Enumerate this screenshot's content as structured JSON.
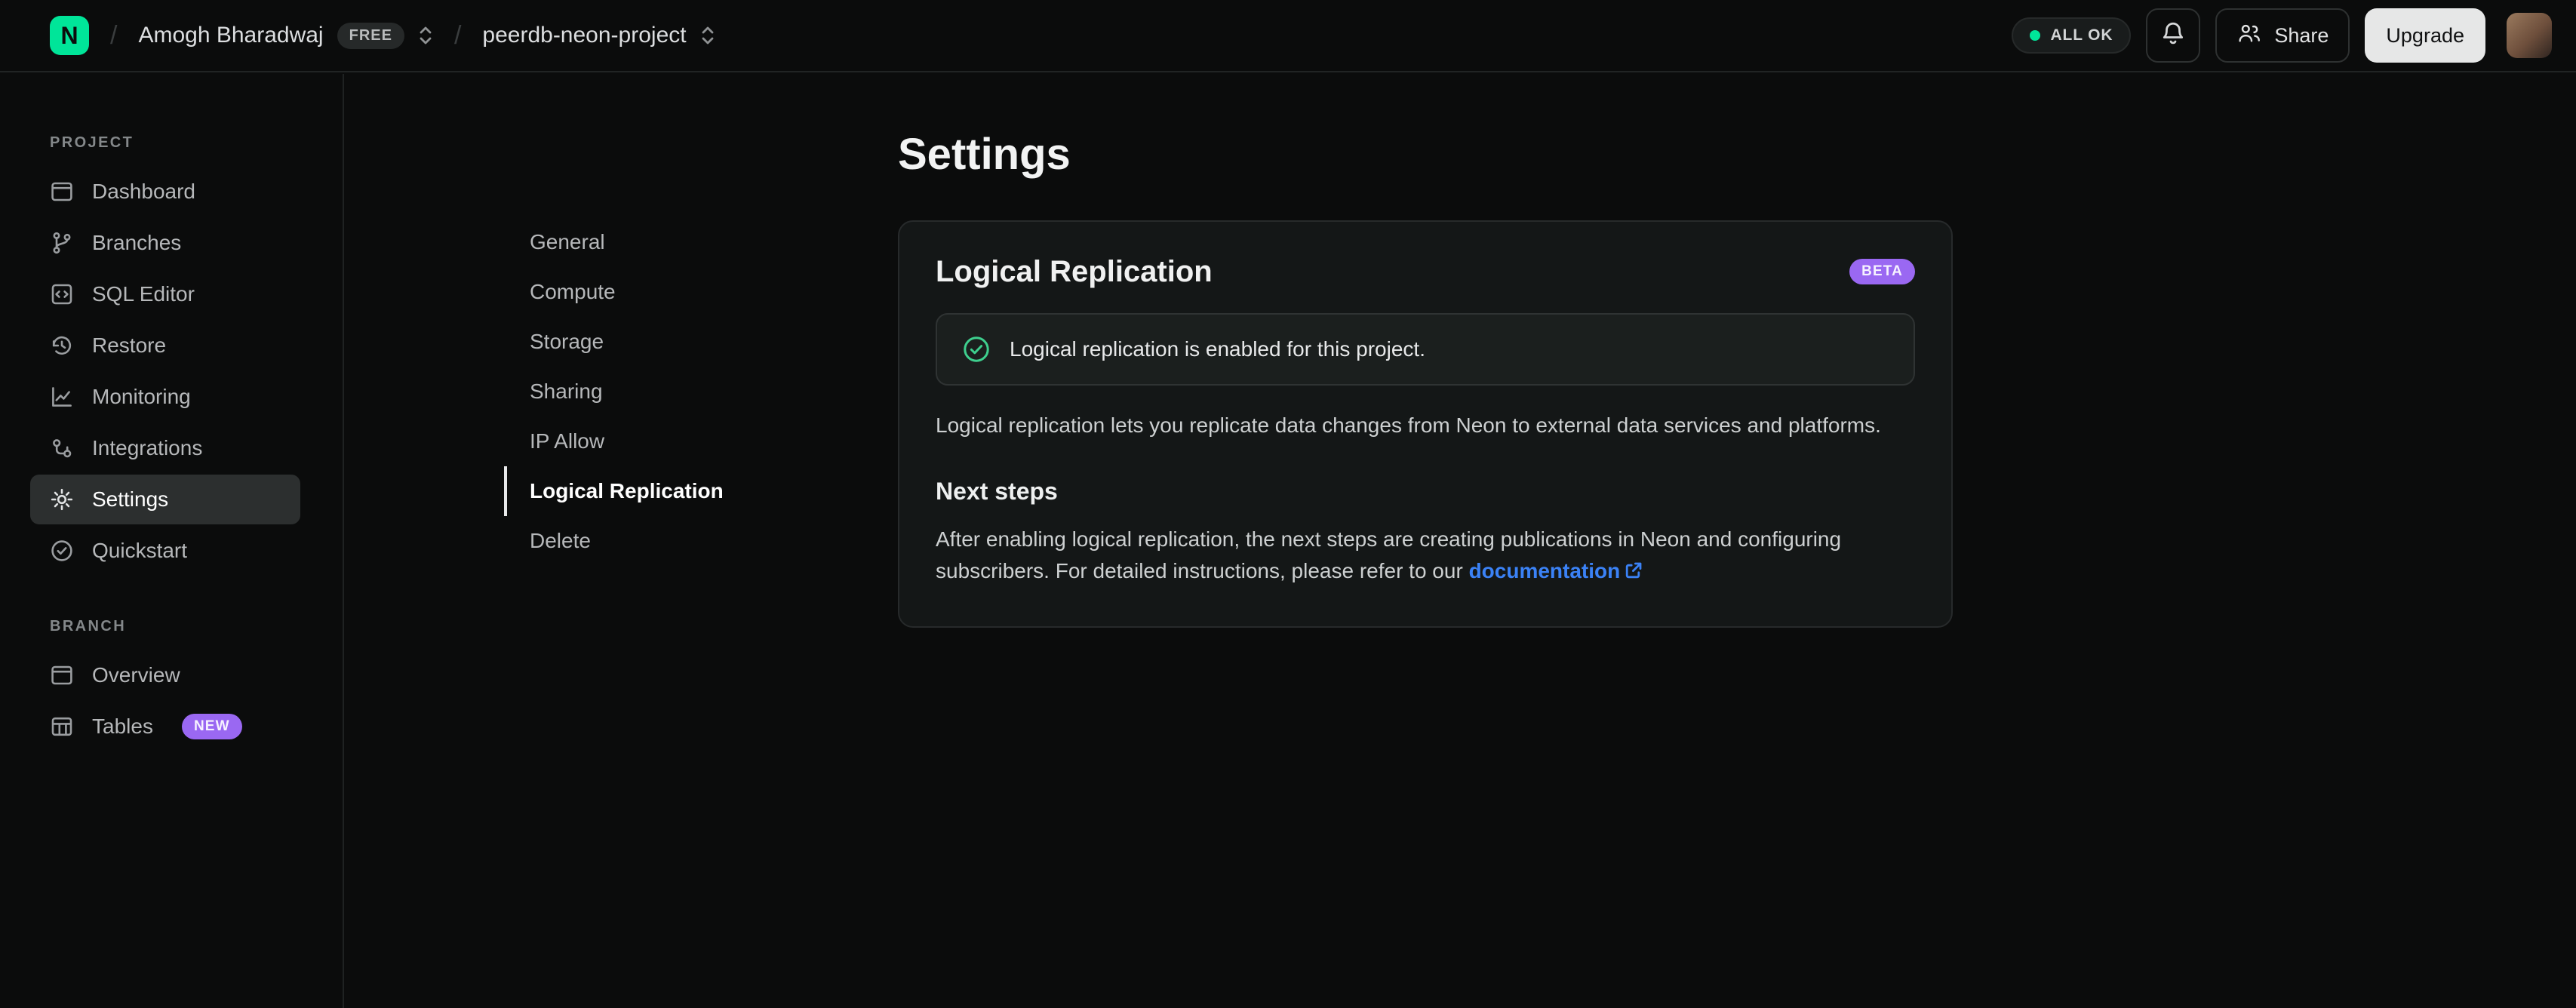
{
  "topbar": {
    "logo_letter": "N",
    "breadcrumb": {
      "org_name": "Amogh Bharadwaj",
      "org_badge": "FREE",
      "project_name": "peerdb-neon-project"
    },
    "status_label": "ALL OK",
    "share_label": "Share",
    "upgrade_label": "Upgrade"
  },
  "sidebar": {
    "sections": [
      {
        "label": "PROJECT",
        "items": [
          {
            "label": "Dashboard",
            "icon": "dashboard-icon"
          },
          {
            "label": "Branches",
            "icon": "branches-icon"
          },
          {
            "label": "SQL Editor",
            "icon": "sql-editor-icon"
          },
          {
            "label": "Restore",
            "icon": "restore-icon"
          },
          {
            "label": "Monitoring",
            "icon": "monitoring-icon"
          },
          {
            "label": "Integrations",
            "icon": "integrations-icon"
          },
          {
            "label": "Settings",
            "icon": "settings-icon"
          },
          {
            "label": "Quickstart",
            "icon": "quickstart-icon"
          }
        ]
      },
      {
        "label": "BRANCH",
        "items": [
          {
            "label": "Overview",
            "icon": "overview-icon"
          },
          {
            "label": "Tables",
            "icon": "tables-icon",
            "badge": "NEW"
          }
        ]
      }
    ]
  },
  "main": {
    "title": "Settings",
    "nav": [
      {
        "label": "General"
      },
      {
        "label": "Compute"
      },
      {
        "label": "Storage"
      },
      {
        "label": "Sharing"
      },
      {
        "label": "IP Allow"
      },
      {
        "label": "Logical Replication"
      },
      {
        "label": "Delete"
      }
    ],
    "active_nav": "Logical Replication",
    "card": {
      "title": "Logical Replication",
      "badge": "BETA",
      "alert_text": "Logical replication is enabled for this project.",
      "description": "Logical replication lets you replicate data changes from Neon to external data services and platforms.",
      "subheading": "Next steps",
      "steps_text": "After enabling logical replication, the next steps are creating publications in Neon and configuring subscribers. For detailed instructions, please refer to our ",
      "link_label": "documentation"
    }
  },
  "colors": {
    "brand_green": "#00e599",
    "status_green": "#00e599",
    "badge_purple": "#9a68f2",
    "link_blue": "#3b82f6"
  }
}
